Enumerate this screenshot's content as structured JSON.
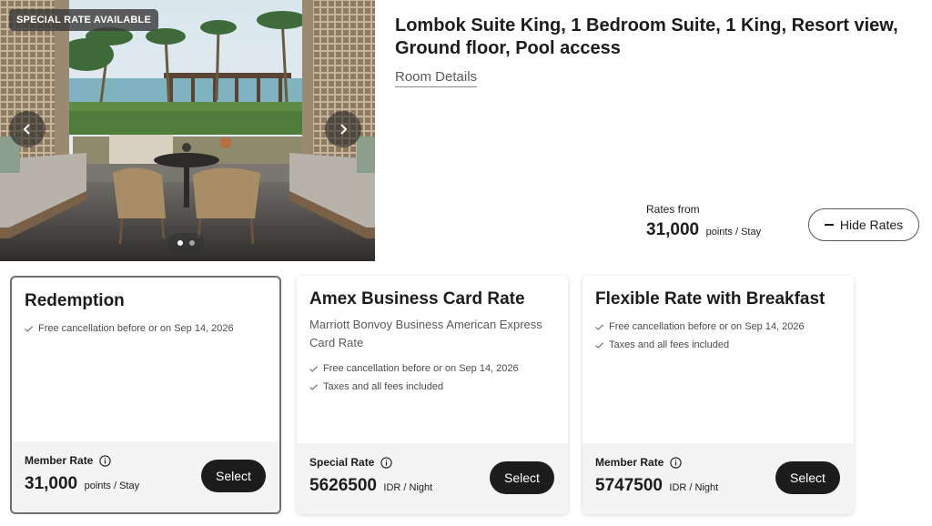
{
  "gallery": {
    "badge": "SPECIAL RATE AVAILABLE",
    "prev_icon": "chevron-left-icon",
    "next_icon": "chevron-right-icon",
    "slide_count": 2,
    "active_slide": 1
  },
  "room": {
    "title": "Lombok Suite King, 1 Bedroom Suite, 1 King, Resort view, Ground floor, Pool access",
    "details_link": "Room Details",
    "rates_from_label": "Rates from",
    "rates_from_value": "31,000",
    "rates_from_unit": "points / Stay",
    "hide_rates_label": "Hide Rates"
  },
  "cards": [
    {
      "title": "Redemption",
      "subtitle": "",
      "features": [
        "Free cancellation before or on Sep 14, 2026"
      ],
      "rate_type": "Member Rate",
      "price": "31,000",
      "unit": "points / Stay",
      "button": "Select"
    },
    {
      "title": "Amex Business Card Rate",
      "subtitle": "Marriott Bonvoy Business American Express Card Rate",
      "features": [
        "Free cancellation before or on Sep 14, 2026",
        "Taxes and all fees included"
      ],
      "rate_type": "Special Rate",
      "price": "5626500",
      "unit": "IDR / Night",
      "button": "Select"
    },
    {
      "title": "Flexible Rate with Breakfast",
      "subtitle": "",
      "features": [
        "Free cancellation before or on Sep 14, 2026",
        "Taxes and all fees included"
      ],
      "rate_type": "Member Rate",
      "price": "5747500",
      "unit": "IDR / Night",
      "button": "Select"
    }
  ],
  "colors": {
    "primary_button": "#1c1c1c",
    "text": "#1c1c1c",
    "muted": "#5a5a5a",
    "footer_bg": "#f4f4f4"
  }
}
